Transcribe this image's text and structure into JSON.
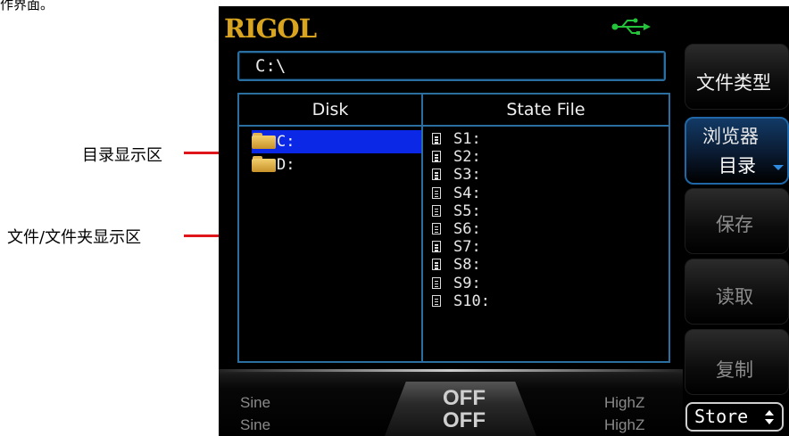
{
  "caption": "作界面。",
  "annotations": {
    "directory_area": "目录显示区",
    "file_area": "文件/文件夹显示区"
  },
  "screen": {
    "logo": "RIGOL",
    "usb_icon": "usb-icon",
    "path": "C:\\",
    "disk_header": "Disk",
    "file_header": "State File",
    "drives": [
      {
        "label": "C:",
        "selected": true
      },
      {
        "label": "D:",
        "selected": false
      }
    ],
    "files": [
      "S1:",
      "S2:",
      "S3:",
      "S4:",
      "S5:",
      "S6:",
      "S7:",
      "S8:",
      "S9:",
      "S10:"
    ],
    "status": {
      "ch1_wave": "Sine",
      "ch2_wave": "Sine",
      "ch1_output": "OFF",
      "ch2_output": "OFF",
      "ch1_load": "HighZ",
      "ch2_load": "HighZ"
    },
    "softkeys": {
      "file_type": "文件类型",
      "browser_line1": "浏览器",
      "browser_line2": "目录",
      "save": "保存",
      "read": "读取",
      "copy": "复制",
      "menu": "Store"
    }
  },
  "colors": {
    "accent_border": "#2b6fa0",
    "selection": "#0a28e6",
    "logo": "#d9a520",
    "arrow": "#e0141b"
  }
}
